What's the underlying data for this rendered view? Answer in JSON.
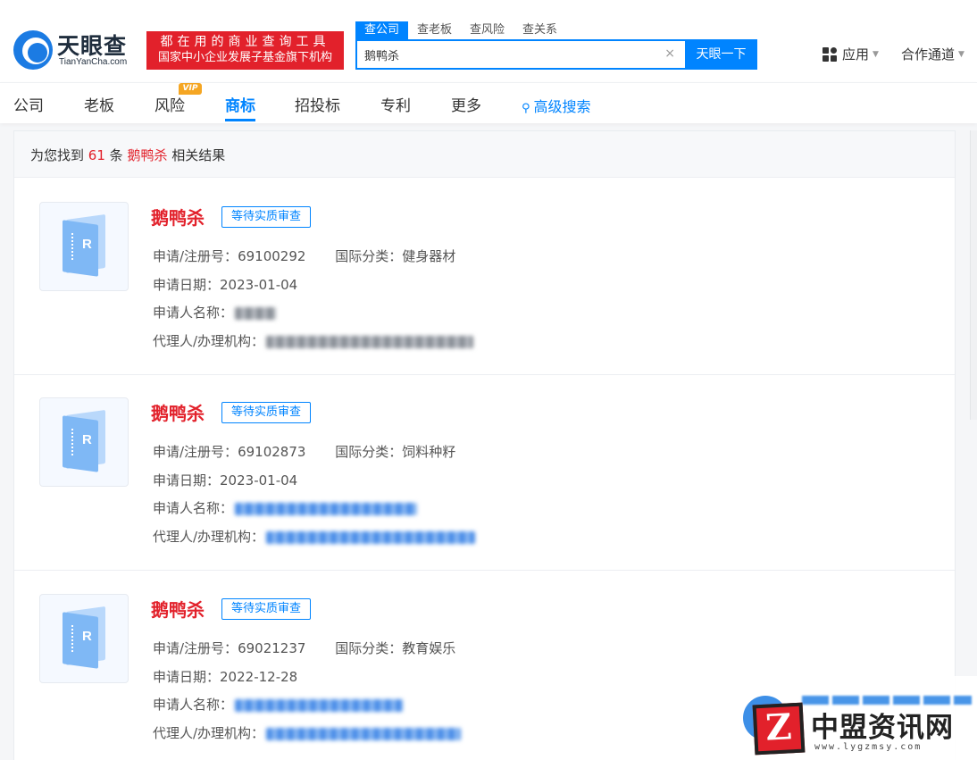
{
  "header": {
    "logo_text": "天眼查",
    "logo_sub": "TianYanCha.com",
    "slogan_line1": "都在用的商业查询工具",
    "slogan_line2": "国家中小企业发展子基金旗下机构",
    "search_tabs": [
      {
        "label": "查公司",
        "active": true
      },
      {
        "label": "查老板",
        "active": false
      },
      {
        "label": "查风险",
        "active": false
      },
      {
        "label": "查关系",
        "active": false
      }
    ],
    "search_value": "鹅鸭杀",
    "search_button": "天眼一下",
    "apps_label": "应用",
    "partner_label": "合作通道"
  },
  "nav": {
    "items": [
      "公司",
      "老板",
      "风险",
      "商标",
      "招投标",
      "专利",
      "更多"
    ],
    "active": "商标",
    "vip_badge": "VIP",
    "advanced_search": "高级搜索"
  },
  "summary": {
    "prefix": "为您找到",
    "count": "61",
    "unit": "条",
    "keyword": "鹅鸭杀",
    "suffix": "相关结果"
  },
  "labels": {
    "reg_no": "申请/注册号：",
    "intl_class": "国际分类：",
    "apply_date": "申请日期：",
    "applicant": "申请人名称：",
    "agent": "代理人/办理机构："
  },
  "results": [
    {
      "name": "鹅鸭杀",
      "status": "等待实质审查",
      "reg_no": "69100292",
      "intl_class": "健身器材",
      "apply_date": "2023-01-04",
      "applicant_redacted": "gray",
      "agent_redacted": "gray"
    },
    {
      "name": "鹅鸭杀",
      "status": "等待实质审查",
      "reg_no": "69102873",
      "intl_class": "饲料种籽",
      "apply_date": "2023-01-04",
      "applicant_redacted": "blue",
      "agent_redacted": "blue"
    },
    {
      "name": "鹅鸭杀",
      "status": "等待实质审查",
      "reg_no": "69021237",
      "intl_class": "教育娱乐",
      "apply_date": "2022-12-28",
      "applicant_redacted": "blue",
      "agent_redacted": "blue"
    }
  ],
  "watermark": {
    "badge": "Z",
    "title": "中盟资讯网",
    "url": "www.lygzmsy.com"
  },
  "colors": {
    "brand_blue": "#0084ff",
    "accent_red": "#e2212b"
  }
}
